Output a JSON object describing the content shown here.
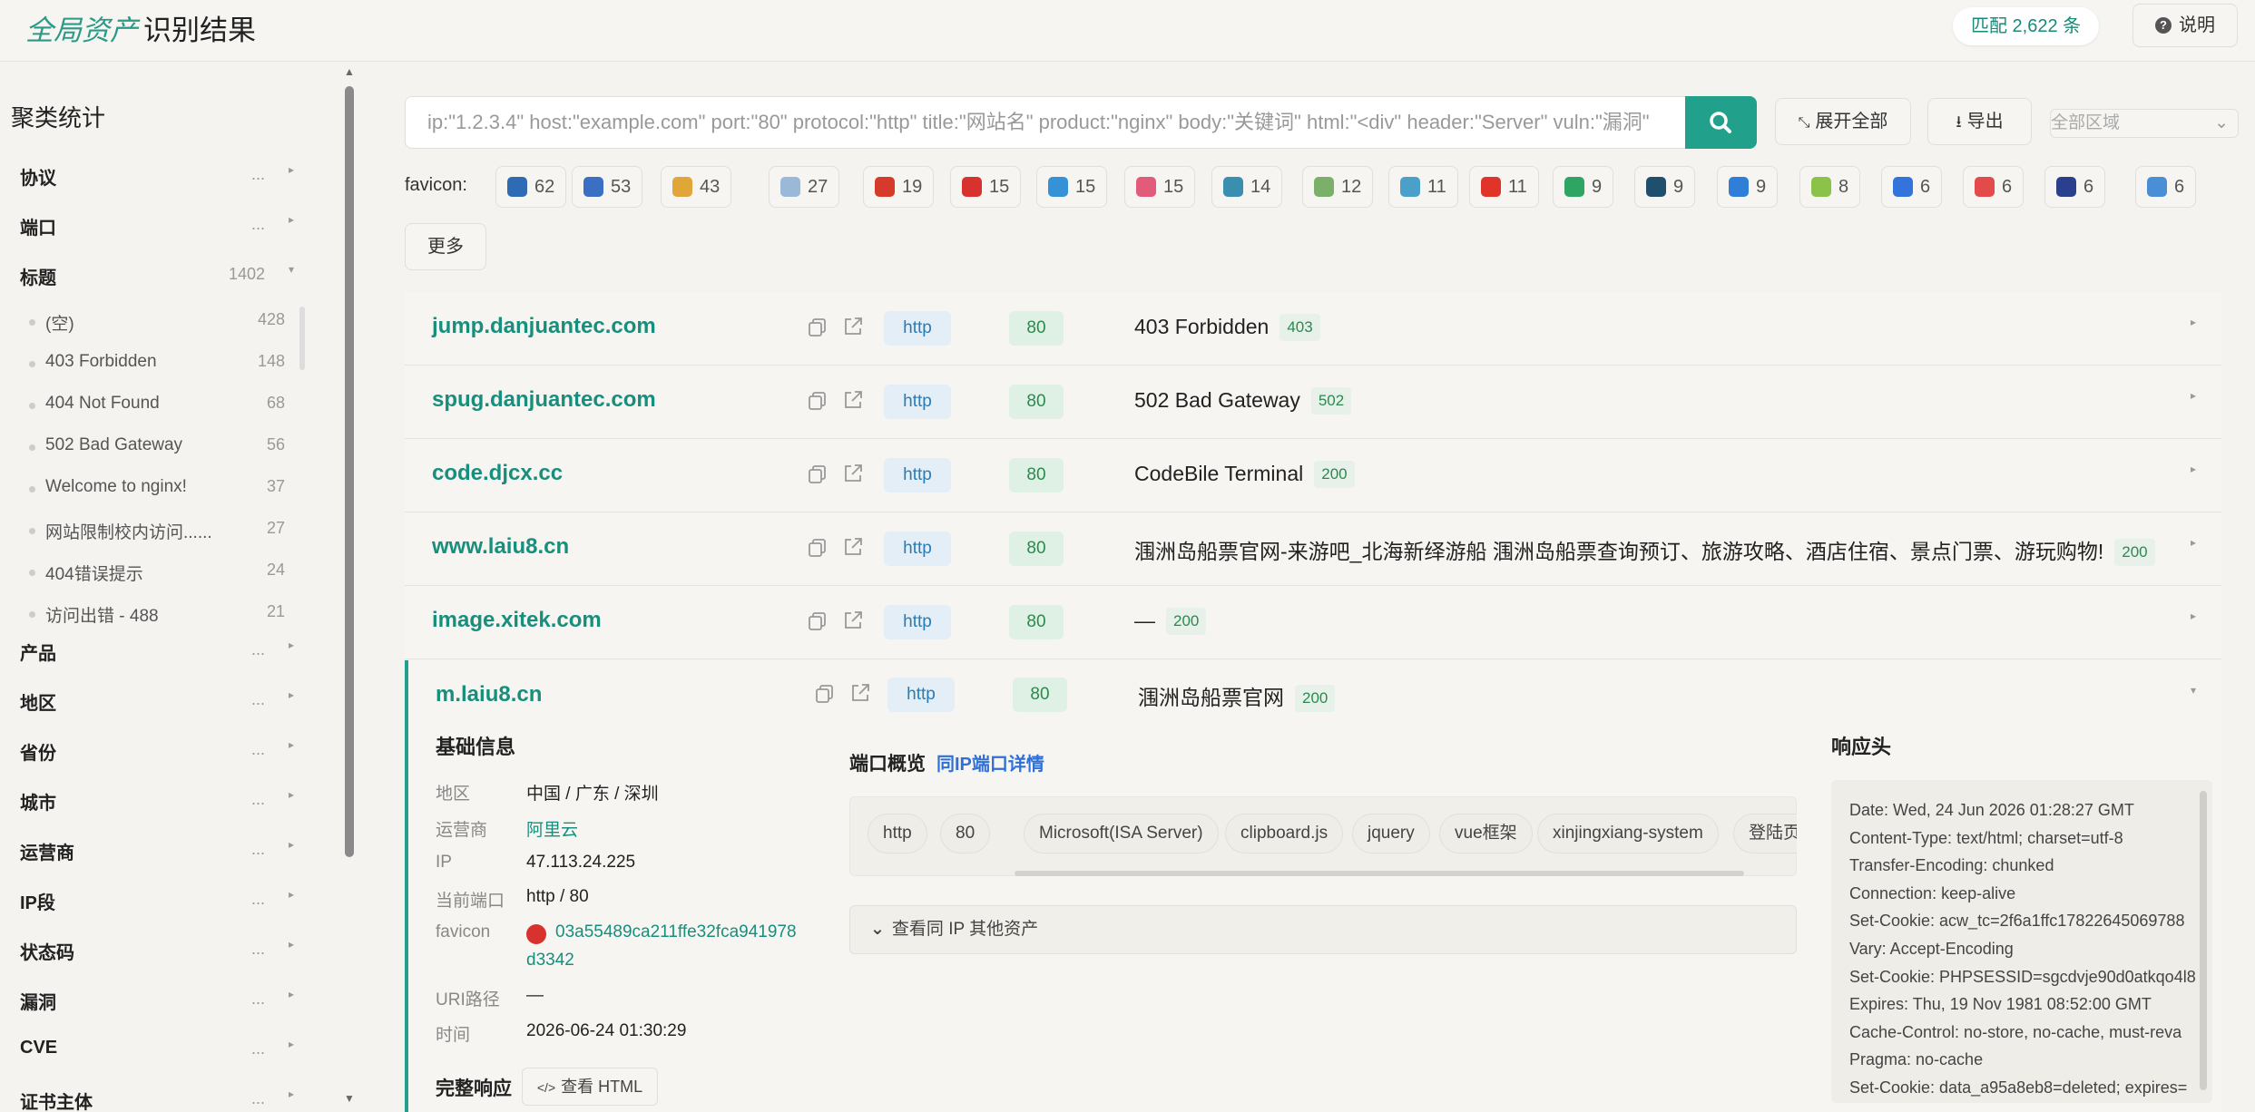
{
  "header": {
    "brand_italic": "全局资产",
    "brand_rest": "识别结果",
    "match_badge": "匹配 2,622 条",
    "help_label": "说明"
  },
  "sidebar": {
    "title": "聚类统计",
    "categories_top": [
      {
        "label": "协议",
        "count": "..."
      },
      {
        "label": "端口",
        "count": "..."
      },
      {
        "label": "标题",
        "count": "1402"
      }
    ],
    "title_items": [
      {
        "label": "(空)",
        "count": "428"
      },
      {
        "label": "403 Forbidden",
        "count": "148"
      },
      {
        "label": "404 Not Found",
        "count": "68"
      },
      {
        "label": "502 Bad Gateway",
        "count": "56"
      },
      {
        "label": "Welcome to nginx!",
        "count": "37"
      },
      {
        "label": "网站限制校内访问......",
        "count": "27"
      },
      {
        "label": "404错误提示",
        "count": "24"
      },
      {
        "label": "访问出错 - 488",
        "count": "21"
      }
    ],
    "categories_bottom": [
      {
        "label": "产品",
        "count": "..."
      },
      {
        "label": "地区",
        "count": "..."
      },
      {
        "label": "省份",
        "count": "..."
      },
      {
        "label": "城市",
        "count": "..."
      },
      {
        "label": "运营商",
        "count": "..."
      },
      {
        "label": "IP段",
        "count": "..."
      },
      {
        "label": "状态码",
        "count": "..."
      },
      {
        "label": "漏洞",
        "count": "..."
      },
      {
        "label": "CVE",
        "count": "..."
      },
      {
        "label": "证书主体",
        "count": "..."
      }
    ]
  },
  "search": {
    "placeholder": "ip:\"1.2.3.4\" host:\"example.com\" port:\"80\" protocol:\"http\" title:\"网站名\" product:\"nginx\" body:\"关键词\" html:\"<div\" header:\"Server\" vuln:\"漏洞\"",
    "expand_label": "展开全部",
    "export_label": "导出",
    "region_label": "全部区域"
  },
  "favicon": {
    "label": "favicon:",
    "chips": [
      {
        "count": "62",
        "color": "#2d6bb5"
      },
      {
        "count": "53",
        "color": "#3a6fc4"
      },
      {
        "count": "43",
        "color": "#e0a63a"
      },
      {
        "count": "27",
        "color": "#9ab8d8"
      },
      {
        "count": "19",
        "color": "#d63a2a"
      },
      {
        "count": "15",
        "color": "#d8322e"
      },
      {
        "count": "15",
        "color": "#3592d6"
      },
      {
        "count": "15",
        "color": "#e35b7b"
      },
      {
        "count": "14",
        "color": "#3a8fb0"
      },
      {
        "count": "12",
        "color": "#7ab06a"
      },
      {
        "count": "11",
        "color": "#4aa0c8"
      },
      {
        "count": "11",
        "color": "#e0342a"
      },
      {
        "count": "9",
        "color": "#2fa563"
      },
      {
        "count": "9",
        "color": "#1f4f6d"
      },
      {
        "count": "9",
        "color": "#2f7fd8"
      },
      {
        "count": "8",
        "color": "#8bc34a"
      },
      {
        "count": "6",
        "color": "#3273dc"
      },
      {
        "count": "6",
        "color": "#e34a4a"
      },
      {
        "count": "6",
        "color": "#2b3f8f"
      },
      {
        "count": "6",
        "color": "#4a8fd6"
      }
    ],
    "more_label": "更多"
  },
  "results": [
    {
      "host": "jump.danjuantec.com",
      "protocol": "http",
      "port": "80",
      "title": "403 Forbidden",
      "status": "403"
    },
    {
      "host": "spug.danjuantec.com",
      "protocol": "http",
      "port": "80",
      "title": "502 Bad Gateway",
      "status": "502"
    },
    {
      "host": "code.djcx.cc",
      "protocol": "http",
      "port": "80",
      "title": "CodeBile Terminal",
      "status": "200"
    },
    {
      "host": "www.laiu8.cn",
      "protocol": "http",
      "port": "80",
      "title": "涠洲岛船票官网-来游吧_北海新绎游船 涠洲岛船票查询预订、旅游攻略、酒店住宿、景点门票、游玩购物!",
      "status": "200"
    },
    {
      "host": "image.xitek.com",
      "protocol": "http",
      "port": "80",
      "title": "—",
      "status": "200"
    }
  ],
  "expanded": {
    "host": "m.laiu8.cn",
    "protocol": "http",
    "port": "80",
    "title": "涠洲岛船票官网",
    "status": "200",
    "basic_title": "基础信息",
    "fields": {
      "region_k": "地区",
      "region_v": "中国 / 广东 / 深圳",
      "isp_k": "运营商",
      "isp_v": "阿里云",
      "ip_k": "IP",
      "ip_v": "47.113.24.225",
      "port_k": "当前端口",
      "port_v": "http / 80",
      "favicon_k": "favicon",
      "favicon_v1": "03a55489ca211ffe32fca941978",
      "favicon_v2": "d3342",
      "uri_k": "URI路径",
      "uri_v": "—",
      "time_k": "时间",
      "time_v": "2026-06-24 01:30:29"
    },
    "full_response": "完整响应",
    "view_html": "查看 HTML",
    "port_overview_title": "端口概览",
    "same_ip_port_link": "同IP端口详情",
    "port_pills": [
      "http",
      "80"
    ],
    "tech_pills": [
      "Microsoft(ISA Server)",
      "clipboard.js",
      "jquery",
      "vue框架",
      "xinjingxiang-system",
      "登陆页面"
    ],
    "same_ip_assets": "查看同 IP 其他资产",
    "headers_title": "响应头",
    "headers": [
      "Date: Wed, 24 Jun 2026 01:28:27 GMT",
      "Content-Type: text/html; charset=utf-8",
      "Transfer-Encoding: chunked",
      "Connection: keep-alive",
      "Set-Cookie: acw_tc=2f6a1ffc17822645069788",
      "Vary: Accept-Encoding",
      "Set-Cookie: PHPSESSID=sgcdvje90d0atkqo4l8",
      "Expires: Thu, 19 Nov 1981 08:52:00 GMT",
      "Cache-Control: no-store, no-cache, must-reva",
      "Pragma: no-cache",
      "Set-Cookie: data_a95a8eb8=deleted; expires="
    ]
  }
}
